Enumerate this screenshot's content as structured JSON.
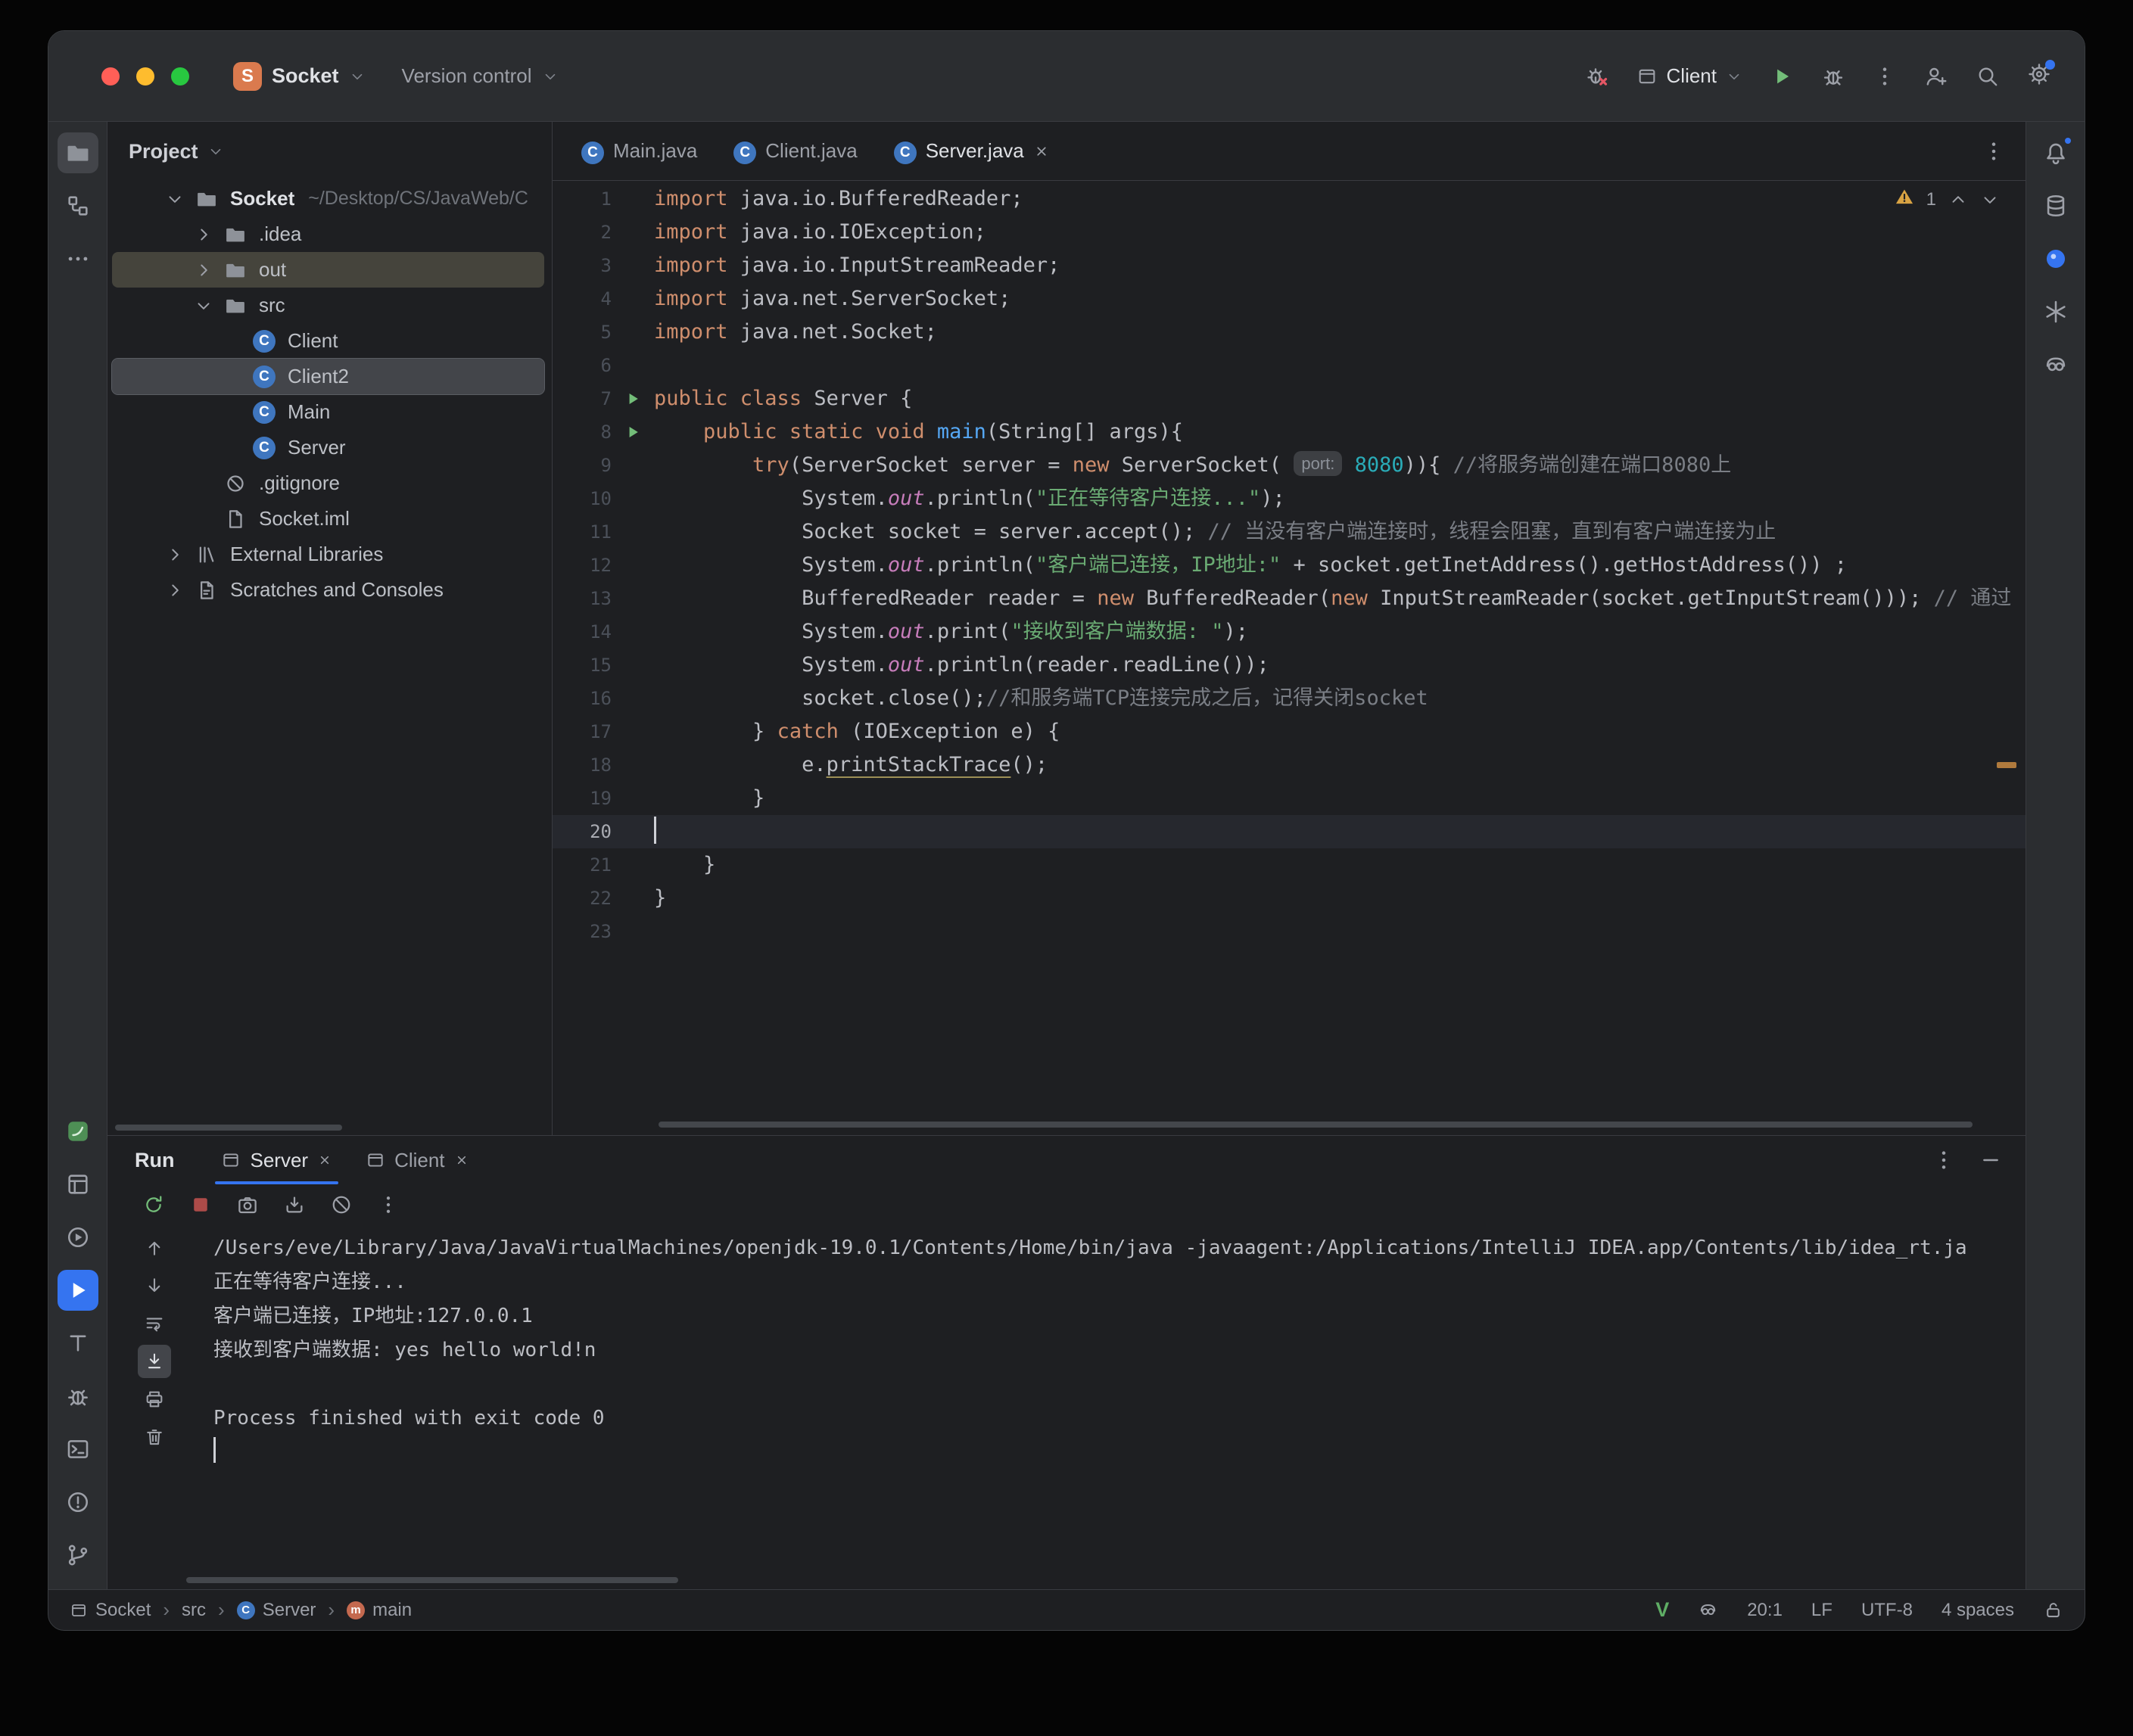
{
  "colors": {
    "accent": "#3574F0",
    "run_green": "#73BD79",
    "warning": "#D9A343",
    "stop_red": "#C75450",
    "keyword": "#CF8E6D",
    "string": "#6AAB73",
    "comment": "#7A7E85",
    "number": "#2AACB8",
    "field": "#C77DBB"
  },
  "titlebar": {
    "project_badge": "S",
    "project_name": "Socket",
    "version_control": "Version control",
    "run_config": "Client"
  },
  "left_toolbar": {
    "top": [
      {
        "id": "project",
        "icon": "folder",
        "active": true
      },
      {
        "id": "structure",
        "icon": "structure"
      },
      {
        "id": "more-tools",
        "icon": "more-h"
      }
    ],
    "bottom": [
      {
        "id": "plugin",
        "icon": "plugin"
      },
      {
        "id": "dependencies",
        "icon": "box"
      },
      {
        "id": "services",
        "icon": "services"
      },
      {
        "id": "run",
        "icon": "play-white",
        "blue": true
      },
      {
        "id": "todo",
        "icon": "todo"
      },
      {
        "id": "debug",
        "icon": "bug"
      },
      {
        "id": "terminal",
        "icon": "terminal"
      },
      {
        "id": "problems",
        "icon": "problems"
      },
      {
        "id": "git",
        "icon": "branch"
      }
    ]
  },
  "right_toolbar": [
    {
      "id": "notifications",
      "icon": "bell",
      "badge": true
    },
    {
      "id": "database",
      "icon": "db"
    },
    {
      "id": "assistant",
      "icon": "blue-dot"
    },
    {
      "id": "chatgpt",
      "icon": "swirl"
    },
    {
      "id": "copilot",
      "icon": "copilot"
    }
  ],
  "project_panel": {
    "title": "Project",
    "tree": [
      {
        "label": "Socket",
        "hint": "~/Desktop/CS/JavaWeb/C",
        "icon": "folder",
        "chevron": "down",
        "indent": 0
      },
      {
        "label": ".idea",
        "icon": "folder",
        "chevron": "right",
        "indent": 1
      },
      {
        "label": "out",
        "icon": "folder",
        "chevron": "right",
        "indent": 1,
        "highlight": "hover"
      },
      {
        "label": "src",
        "icon": "folder",
        "chevron": "down",
        "indent": 1
      },
      {
        "label": "Client",
        "icon": "class",
        "indent": 2
      },
      {
        "label": "Client2",
        "icon": "class",
        "indent": 2,
        "highlight": "selected"
      },
      {
        "label": "Main",
        "icon": "class",
        "indent": 2
      },
      {
        "label": "Server",
        "icon": "class",
        "indent": 2
      },
      {
        "label": ".gitignore",
        "icon": "ignore",
        "indent": 1
      },
      {
        "label": "Socket.iml",
        "icon": "file",
        "indent": 1
      },
      {
        "label": "External Libraries",
        "icon": "lib",
        "chevron": "right",
        "indent": 0
      },
      {
        "label": "Scratches and Consoles",
        "icon": "scratch",
        "chevron": "right",
        "indent": 0
      }
    ]
  },
  "editor": {
    "tabs": [
      {
        "label": "Main.java",
        "icon": "class"
      },
      {
        "label": "Client.java",
        "icon": "class"
      },
      {
        "label": "Server.java",
        "icon": "class",
        "active": true,
        "closable": true
      }
    ],
    "inspection_count": "1",
    "current_line": 20,
    "run_lines": [
      7,
      8
    ],
    "lines": [
      {
        "n": 1,
        "s": [
          [
            "k",
            "import"
          ],
          [
            "d",
            " java.io.BufferedReader;"
          ]
        ]
      },
      {
        "n": 2,
        "s": [
          [
            "k",
            "import"
          ],
          [
            "d",
            " java.io.IOException;"
          ]
        ]
      },
      {
        "n": 3,
        "s": [
          [
            "k",
            "import"
          ],
          [
            "d",
            " java.io.InputStreamReader;"
          ]
        ]
      },
      {
        "n": 4,
        "s": [
          [
            "k",
            "import"
          ],
          [
            "d",
            " java.net.ServerSocket;"
          ]
        ]
      },
      {
        "n": 5,
        "s": [
          [
            "k",
            "import"
          ],
          [
            "d",
            " java.net.Socket;"
          ]
        ]
      },
      {
        "n": 6,
        "s": []
      },
      {
        "n": 7,
        "s": [
          [
            "k",
            "public class"
          ],
          [
            "d",
            " Server {"
          ]
        ]
      },
      {
        "n": 8,
        "s": [
          [
            "d",
            "    "
          ],
          [
            "k",
            "public static void"
          ],
          [
            "m",
            " main"
          ],
          [
            "d",
            "(String[] args){"
          ]
        ]
      },
      {
        "n": 9,
        "s": [
          [
            "d",
            "        "
          ],
          [
            "k",
            "try"
          ],
          [
            "d",
            "(ServerSocket server = "
          ],
          [
            "k",
            "new"
          ],
          [
            "d",
            " ServerSocket( "
          ],
          [
            "h",
            "port:"
          ],
          [
            "n",
            " 8080"
          ],
          [
            "d",
            ")){ "
          ],
          [
            "c",
            "//将服务端创建在端口8080上"
          ]
        ]
      },
      {
        "n": 10,
        "s": [
          [
            "d",
            "            System."
          ],
          [
            "f",
            "out"
          ],
          [
            "d",
            ".println("
          ],
          [
            "s",
            "\"正在等待客户连接...\""
          ],
          [
            "d",
            ");"
          ]
        ]
      },
      {
        "n": 11,
        "s": [
          [
            "d",
            "            Socket socket = server.accept(); "
          ],
          [
            "c",
            "// 当没有客户端连接时，线程会阻塞，直到有客户端连接为止"
          ]
        ]
      },
      {
        "n": 12,
        "s": [
          [
            "d",
            "            System."
          ],
          [
            "f",
            "out"
          ],
          [
            "d",
            ".println("
          ],
          [
            "s",
            "\"客户端已连接，IP地址:\""
          ],
          [
            "d",
            " + socket.getInetAddress().getHostAddress()) ;"
          ]
        ]
      },
      {
        "n": 13,
        "s": [
          [
            "d",
            "            BufferedReader reader = "
          ],
          [
            "k",
            "new"
          ],
          [
            "d",
            " BufferedReader("
          ],
          [
            "k",
            "new"
          ],
          [
            "d",
            " InputStreamReader(socket.getInputStream())); "
          ],
          [
            "c",
            "// 通过"
          ]
        ]
      },
      {
        "n": 14,
        "s": [
          [
            "d",
            "            System."
          ],
          [
            "f",
            "out"
          ],
          [
            "d",
            ".print("
          ],
          [
            "s",
            "\"接收到客户端数据: \""
          ],
          [
            "d",
            ");"
          ]
        ]
      },
      {
        "n": 15,
        "s": [
          [
            "d",
            "            System."
          ],
          [
            "f",
            "out"
          ],
          [
            "d",
            ".println(reader.readLine());"
          ]
        ]
      },
      {
        "n": 16,
        "s": [
          [
            "d",
            "            socket.close();"
          ],
          [
            "c",
            "//和服务端TCP连接完成之后，记得关闭socket"
          ]
        ]
      },
      {
        "n": 17,
        "s": [
          [
            "d",
            "        } "
          ],
          [
            "k",
            "catch"
          ],
          [
            "d",
            " (IOException e) {"
          ]
        ]
      },
      {
        "n": 18,
        "s": [
          [
            "d",
            "            e."
          ],
          [
            "w",
            "printStackTrace"
          ],
          [
            "d",
            "();"
          ]
        ]
      },
      {
        "n": 19,
        "s": [
          [
            "d",
            "        }"
          ]
        ]
      },
      {
        "n": 20,
        "s": []
      },
      {
        "n": 21,
        "s": [
          [
            "d",
            "    }"
          ]
        ]
      },
      {
        "n": 22,
        "s": [
          [
            "d",
            "}"
          ]
        ]
      },
      {
        "n": 23,
        "s": []
      }
    ]
  },
  "run_panel": {
    "title": "Run",
    "tabs": [
      {
        "label": "Server",
        "icon": "win",
        "active": true
      },
      {
        "label": "Client",
        "icon": "win"
      }
    ],
    "console": [
      "/Users/eve/Library/Java/JavaVirtualMachines/openjdk-19.0.1/Contents/Home/bin/java -javaagent:/Applications/IntelliJ IDEA.app/Contents/lib/idea_rt.ja",
      "正在等待客户连接...",
      "客户端已连接，IP地址:127.0.0.1",
      "接收到客户端数据: yes hello world!n",
      "",
      "Process finished with exit code 0"
    ]
  },
  "status_bar": {
    "breadcrumbs": [
      {
        "label": "Socket",
        "icon": "win"
      },
      {
        "label": "src"
      },
      {
        "label": "Server",
        "icon": "class"
      },
      {
        "label": "main",
        "icon": "method"
      }
    ],
    "vim": "V",
    "caret": "20:1",
    "line_ending": "LF",
    "encoding": "UTF-8",
    "indent": "4 spaces"
  }
}
